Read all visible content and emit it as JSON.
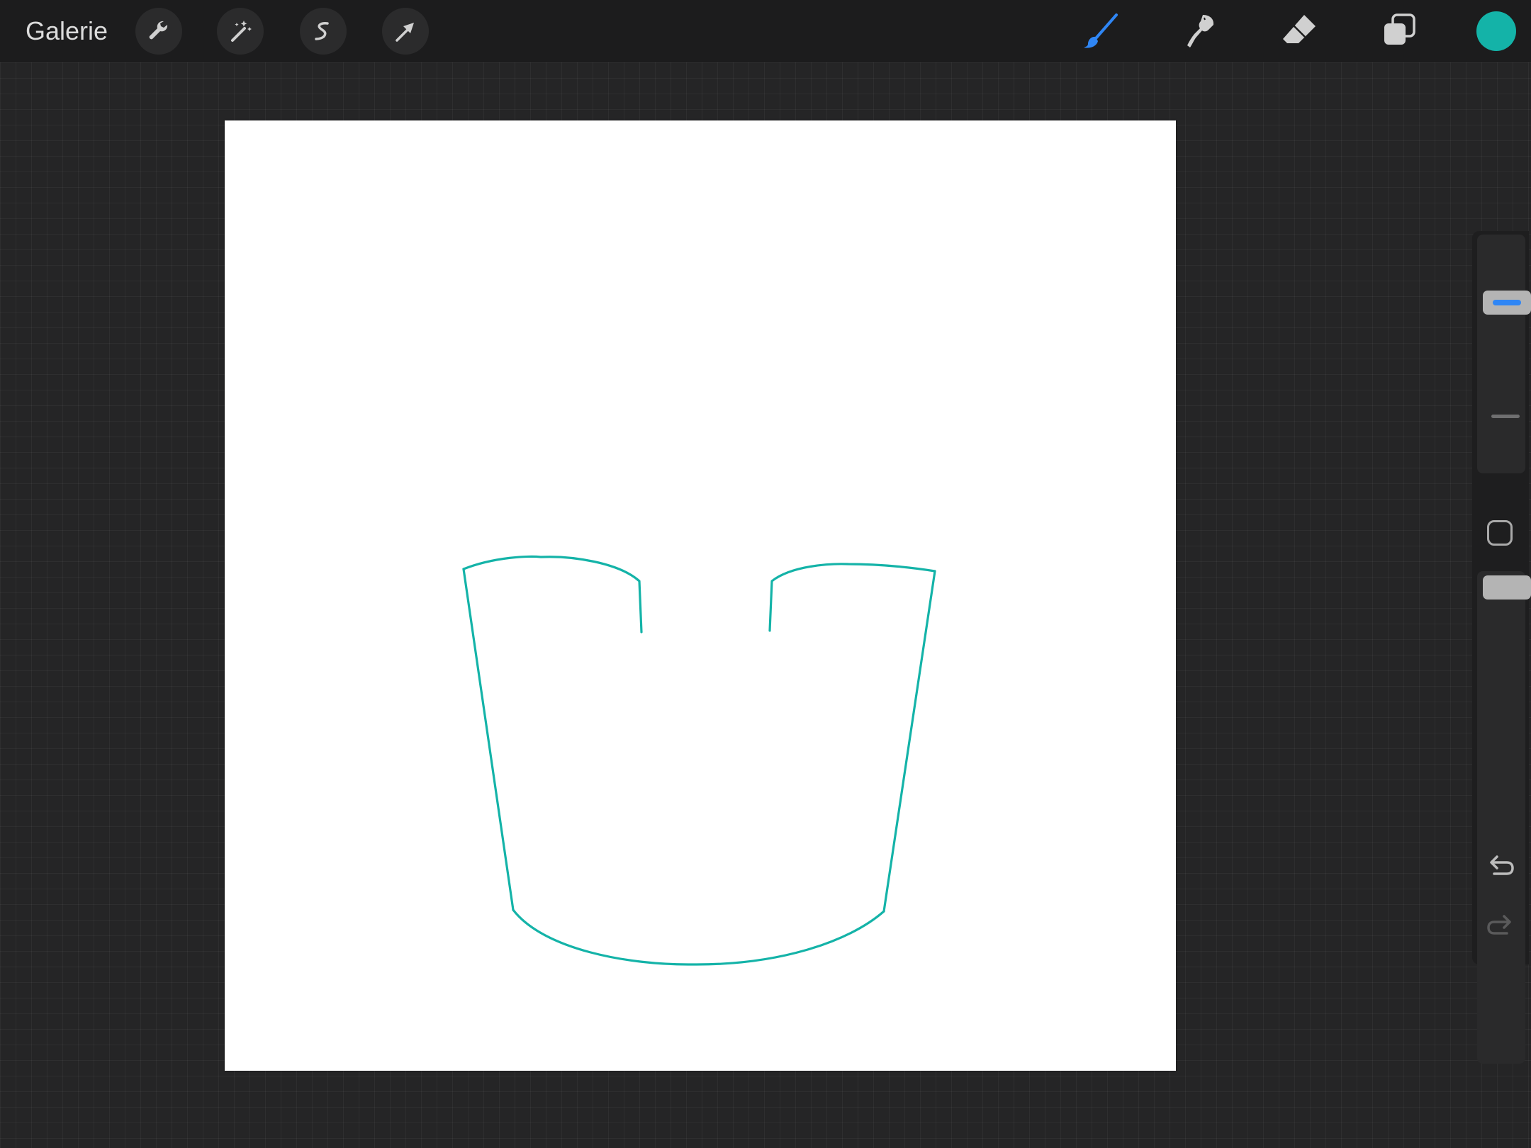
{
  "topbar": {
    "gallery_label": "Galerie",
    "left_tools": [
      "wrench-icon",
      "magic-wand-icon",
      "selection-icon",
      "transform-arrow-icon"
    ],
    "right_tools": [
      "brush-icon",
      "smudge-icon",
      "eraser-icon",
      "layers-icon"
    ],
    "active_tool": "brush",
    "current_color": "#14b3a8",
    "accent_color": "#2f86f5"
  },
  "canvas": {
    "background": "#ffffff",
    "stroke_color": "#14b3a8"
  },
  "sidebar": {
    "brush_size_level": 0.25,
    "opacity_level": 0.0,
    "buttons": [
      "modify-square-icon",
      "undo-icon",
      "redo-icon"
    ],
    "redo_enabled": false
  }
}
